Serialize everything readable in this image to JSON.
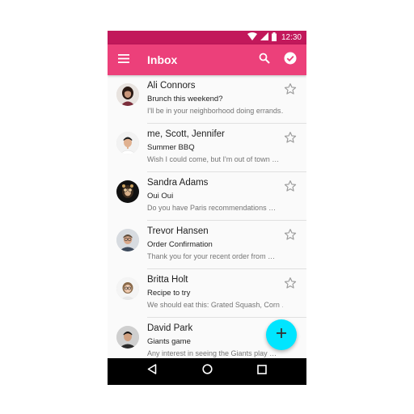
{
  "status_bar": {
    "time": "12:30",
    "icons": [
      "wifi-icon",
      "signal-icon",
      "battery-icon"
    ]
  },
  "app_bar": {
    "title": "Inbox",
    "color": "#ec407a",
    "status_color": "#c2185b",
    "icons": [
      "menu-icon",
      "search-icon",
      "check-circle-icon"
    ]
  },
  "messages": [
    {
      "sender": "Ali Connors",
      "subject": "Brunch this weekend?",
      "preview": "I'll be in your neighborhood doing errands…",
      "starred": false
    },
    {
      "sender": "me, Scott, Jennifer",
      "subject": "Summer BBQ",
      "preview": "Wish I could come, but I'm out of town …",
      "starred": false
    },
    {
      "sender": "Sandra Adams",
      "subject": "Oui Oui",
      "preview": "Do you have Paris recommendations …",
      "starred": false
    },
    {
      "sender": "Trevor Hansen",
      "subject": "Order Confirmation",
      "preview": "Thank you for your recent order from …",
      "starred": false
    },
    {
      "sender": "Britta Holt",
      "subject": "Recipe to try",
      "preview": "We should eat this: Grated Squash, Corn …",
      "starred": false
    },
    {
      "sender": "David Park",
      "subject": "Giants game",
      "preview": "Any interest in seeing the Giants play …",
      "starred": false
    }
  ],
  "fab": {
    "icon": "plus-icon",
    "color": "#00e5ff"
  },
  "nav_bar": {
    "icons": [
      "back-icon",
      "home-icon",
      "recents-icon"
    ]
  }
}
